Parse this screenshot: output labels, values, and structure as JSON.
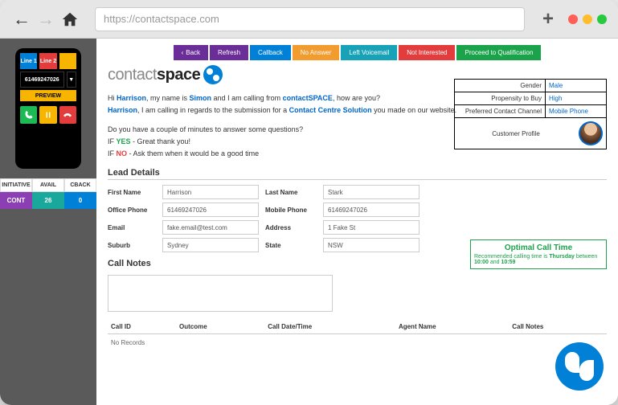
{
  "browser": {
    "url": "https://contactspace.com"
  },
  "sidebar": {
    "tiles": {
      "line1": "Line 1",
      "line2": "Line 2"
    },
    "number": "61469247026",
    "preview": "PREVIEW",
    "status_headers": [
      "INITIATIVE",
      "AVAIL",
      "CBACK"
    ],
    "status_values": {
      "initiative": "CONT",
      "avail": "26",
      "cback": "0"
    }
  },
  "actions": {
    "back": "Back",
    "refresh": "Refresh",
    "callback": "Callback",
    "no_answer": "No Answer",
    "left_voicemail": "Left Voicemail",
    "not_interested": "Not Interested",
    "proceed": "Proceed to Qualification"
  },
  "logo": {
    "part1": "contact",
    "part2": "space"
  },
  "script": {
    "greeting_pre": "Hi ",
    "greeting_name": "Harrison",
    "greeting_mid": ", my name is ",
    "agent_name": "Simon",
    "greeting_mid2": " and I am calling from ",
    "brand": "contactSPACE",
    "greeting_post": ", how are you?",
    "line2a": "Harrison",
    "line2b": ", I am calling in regards to the submission for a ",
    "line2c": "Contact Centre Solution",
    "line2d": " you made on our website.",
    "q": "Do you have a couple of minutes to answer some questions?",
    "yes_label": "YES",
    "yes_text": " - Great thank you!",
    "no_label": "NO",
    "no_text": " - Ask them when it would be a good time",
    "if": "IF "
  },
  "profile": {
    "gender_label": "Gender",
    "gender": "Male",
    "propensity_label": "Propensity to Buy",
    "propensity": "High",
    "channel_label": "Preferred Contact Channel",
    "channel": "Mobile Phone",
    "footer": "Customer Profile"
  },
  "optimal": {
    "title": "Optimal Call Time",
    "pre": "Recommended calling time is ",
    "day": "Thursday",
    "mid": " between ",
    "t1": "10:00",
    "and": " and ",
    "t2": "10:59"
  },
  "lead": {
    "title": "Lead Details",
    "first_name_lbl": "First Name",
    "first_name": "Harrison",
    "last_name_lbl": "Last Name",
    "last_name": "Stark",
    "office_lbl": "Office Phone",
    "office": "61469247026",
    "mobile_lbl": "Mobile Phone",
    "mobile": "61469247026",
    "email_lbl": "Email",
    "email": "fake.email@test.com",
    "address_lbl": "Address",
    "address": "1 Fake St",
    "suburb_lbl": "Suburb",
    "suburb": "Sydney",
    "state_lbl": "State",
    "state": "NSW"
  },
  "notes": {
    "title": "Call Notes"
  },
  "table": {
    "cols": [
      "Call ID",
      "Outcome",
      "Call Date/Time",
      "Agent Name",
      "Call Notes"
    ],
    "empty": "No Records"
  }
}
